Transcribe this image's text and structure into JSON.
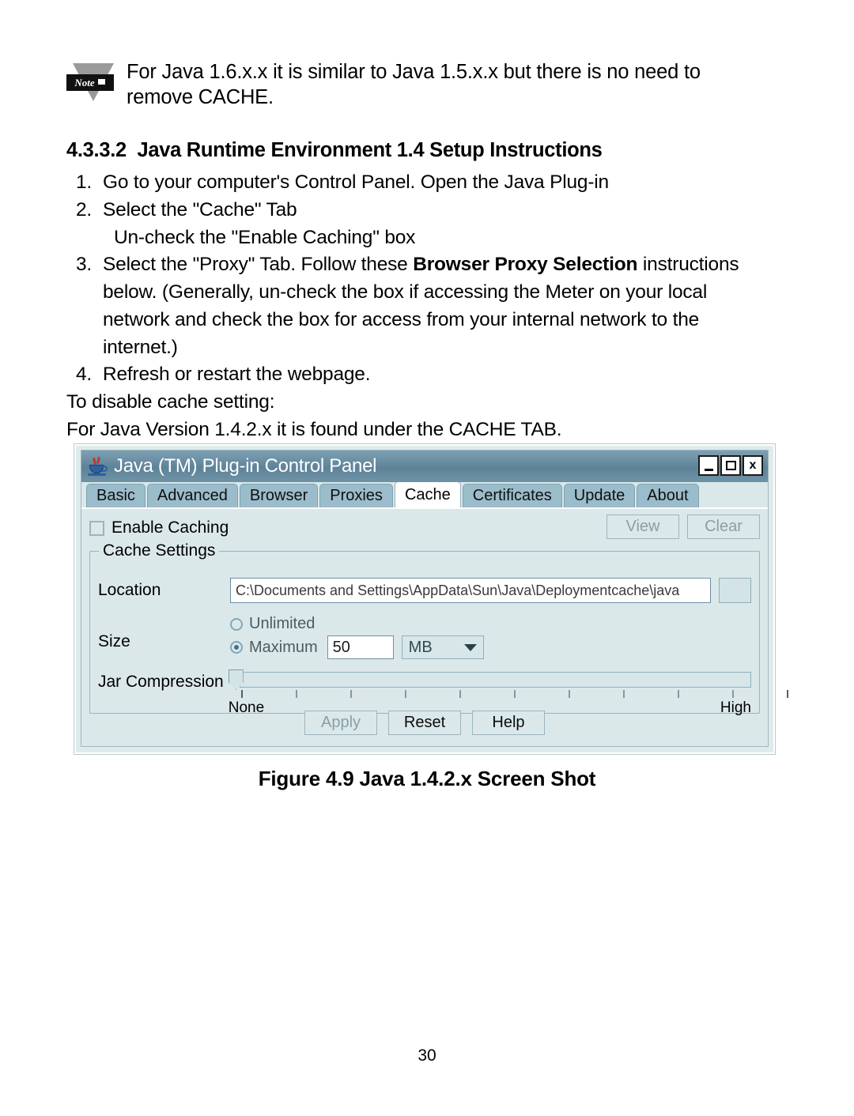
{
  "note": {
    "icon_label": "Note",
    "text": "For Java 1.6.x.x it is similar to Java 1.5.x.x but there is no need to remove CACHE."
  },
  "heading": "4.3.3.2  Java Runtime Environment 1.4 Setup Instructions",
  "steps": [
    {
      "num": "1.",
      "text": "Go to your computer's Control Panel. Open the Java Plug-in"
    },
    {
      "num": "2.",
      "text": "Select the \"Cache\" Tab"
    },
    {
      "num": "4.",
      "text": "Refresh or restart the webpage."
    }
  ],
  "step2_sub": "Un-check the \"Enable Caching\" box",
  "step3": {
    "num": "3.",
    "part1": "Select the \"Proxy\" Tab.  Follow these ",
    "bold": "Browser Proxy Selection",
    "part2": " instructions below. (Generally, un-check the box if accessing the Meter on your local network and check the box for access from your internal network to the internet.)"
  },
  "trailing_lines": [
    "To disable cache setting:",
    "For Java Version 1.4.2.x it is found under the CACHE TAB."
  ],
  "control_panel": {
    "title": "Java (TM) Plug-in Control Panel",
    "window_buttons": {
      "minimize": "_",
      "maximize": "□",
      "close": "x"
    },
    "tabs": [
      {
        "label": "Basic",
        "active": false
      },
      {
        "label": "Advanced",
        "active": false
      },
      {
        "label": "Browser",
        "active": false
      },
      {
        "label": "Proxies",
        "active": false
      },
      {
        "label": "Cache",
        "active": true
      },
      {
        "label": "Certificates",
        "active": false
      },
      {
        "label": "Update",
        "active": false
      },
      {
        "label": "About",
        "active": false
      }
    ],
    "enable_caching": {
      "label": "Enable Caching",
      "checked": false
    },
    "view_button": "View",
    "clear_button": "Clear",
    "group_title": "Cache Settings",
    "location": {
      "label": "Location",
      "value": "C:\\Documents and Settings\\AppData\\Sun\\Java\\Deploymentcache\\java"
    },
    "size": {
      "label": "Size",
      "unlimited_label": "Unlimited",
      "maximum_label": "Maximum",
      "maximum_value": "50",
      "unit": "MB",
      "selected": "Maximum"
    },
    "jar_compression": {
      "label": "Jar Compression",
      "min_label": "None",
      "max_label": "High",
      "value_percent": 0,
      "tick_count": 11
    },
    "buttons": {
      "apply": "Apply",
      "reset": "Reset",
      "help": "Help"
    },
    "colors": {
      "titlebar": "#5d8399",
      "tab_inactive": "#9bbccb",
      "tab_active": "#ffffff",
      "panel_bg": "#dbe8ea",
      "border": "#9ab4be"
    }
  },
  "figure_caption": "Figure 4.9  Java 1.4.2.x Screen Shot",
  "page_number": "30"
}
